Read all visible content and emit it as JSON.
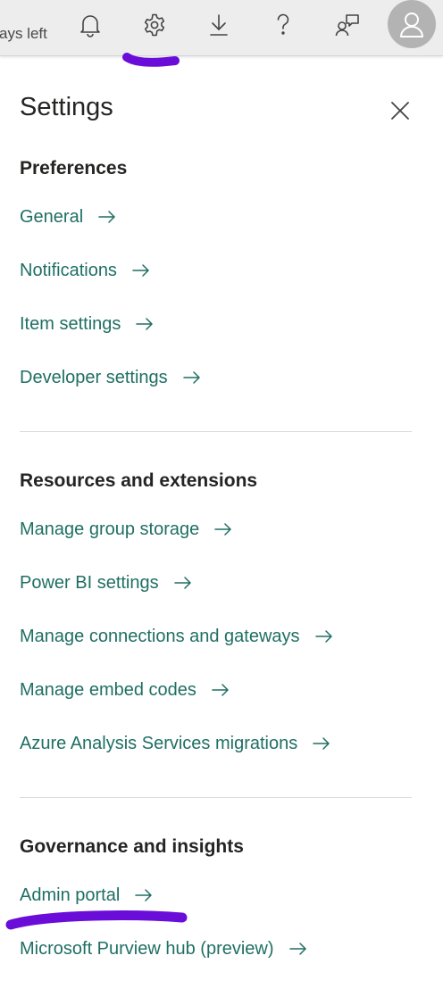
{
  "header": {
    "trial_text": "ays left",
    "icons": {
      "notifications": "bell-icon",
      "settings": "gear-icon",
      "download": "download-icon",
      "help": "question-icon",
      "feedback": "feedback-icon",
      "account": "person-icon"
    }
  },
  "panel": {
    "title": "Settings",
    "sections": [
      {
        "title": "Preferences",
        "links": [
          "General",
          "Notifications",
          "Item settings",
          "Developer settings"
        ]
      },
      {
        "title": "Resources and extensions",
        "links": [
          "Manage group storage",
          "Power BI settings",
          "Manage connections and gateways",
          "Manage embed codes",
          "Azure Analysis Services migrations"
        ]
      },
      {
        "title": "Governance and insights",
        "links": [
          "Admin portal",
          "Microsoft Purview hub (preview)"
        ]
      }
    ]
  },
  "colors": {
    "link": "#1f6f64",
    "header_bg": "#ededed",
    "highlighter": "#6a0dd8"
  }
}
